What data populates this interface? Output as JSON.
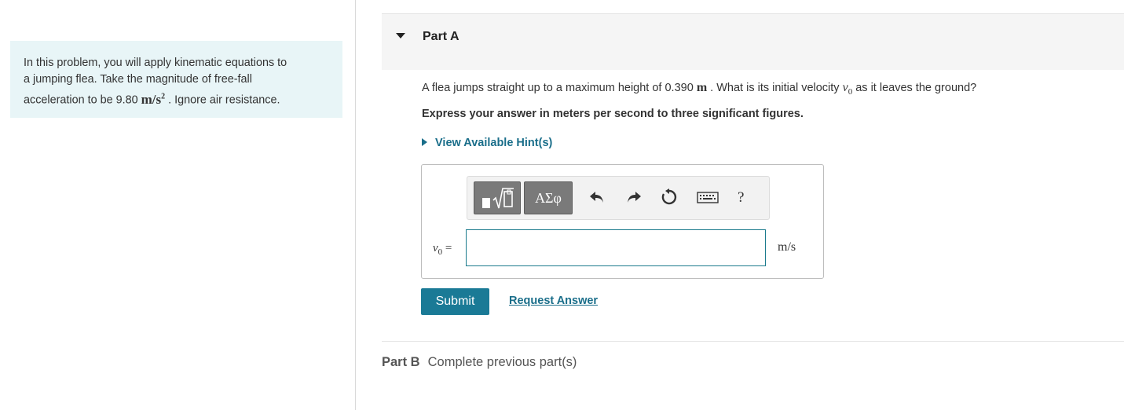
{
  "intro": {
    "line1": "In this problem, you will apply kinematic equations to",
    "line2": "a jumping flea. Take the magnitude of free-fall",
    "line3_prefix": "acceleration to be 9.80",
    "unit_base": "m/s",
    "unit_exp": "2",
    "line3_suffix": ". Ignore air resistance."
  },
  "part_a": {
    "title": "Part A",
    "question_prefix": "A flea jumps straight up to a maximum height of 0.390",
    "question_unit": "m",
    "question_mid": ". What is its initial velocity",
    "variable": "v",
    "variable_sub": "0",
    "question_suffix": "as it leaves the ground?",
    "instruction": "Express your answer in meters per second to three significant figures.",
    "hint_label": "View Available Hint(s)"
  },
  "toolbar": {
    "templates_icon": "templates-icon",
    "greek_label": "ΑΣφ",
    "undo_icon": "undo-icon",
    "redo_icon": "redo-icon",
    "reset_icon": "reset-icon",
    "keyboard_icon": "keyboard-icon",
    "help_label": "?"
  },
  "answer": {
    "label_var": "v",
    "label_sub": "0",
    "label_eq": "=",
    "value": "",
    "units": "m/s"
  },
  "actions": {
    "submit_label": "Submit",
    "request_label": "Request Answer"
  },
  "part_b": {
    "label": "Part B",
    "status": "Complete previous part(s)"
  },
  "colors": {
    "accent": "#1a7a96",
    "link": "#1a6e8a",
    "intro_bg": "#e8f5f7"
  }
}
